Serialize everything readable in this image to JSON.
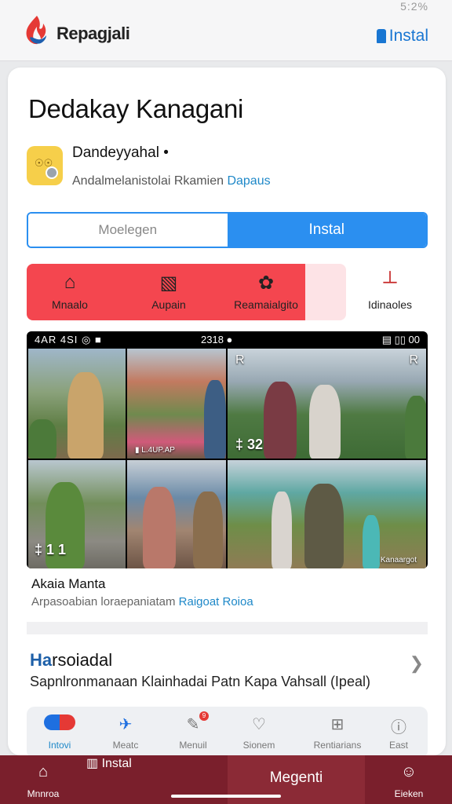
{
  "status": {
    "text": "5:2%"
  },
  "header": {
    "brand": "Repagjali",
    "install_label": "Instal"
  },
  "page": {
    "title": "Dedakay Kanagani"
  },
  "developer": {
    "name": "Dandeyyahal •",
    "subtitle": "Andalmelanistolai Rkamien",
    "link": "Dapaus"
  },
  "actions": {
    "secondary": "Moelegen",
    "primary": "Instal"
  },
  "categories": [
    {
      "label": "Mnaalo",
      "icon": "house-icon"
    },
    {
      "label": "Aupain",
      "icon": "puzzle-icon"
    },
    {
      "label": "Reamaialgito",
      "icon": "flower-icon"
    },
    {
      "label": "Idinaoles",
      "icon": "lamp-icon"
    }
  ],
  "gallery": {
    "status_left": "4AR 4SI ◎ ■",
    "status_center": "2318 ●",
    "status_right": "▤ ▯▯ 00",
    "tile_badge_1": "‡ 32",
    "tile_badge_2": "‡ 1 1",
    "caption_1": "▮ L.4UP.AP",
    "caption_2": "Kanaargot",
    "corner_marks": [
      "R",
      "R"
    ]
  },
  "app": {
    "name": "Akaia Manta",
    "description": "Arpasoabian loraepaniatam",
    "link": "Raigoat Roioa"
  },
  "section": {
    "title_accent": "Ha",
    "title_rest": "rsoiadal",
    "subtitle": "Sapnlronmanaan Klainhadai Patn Kapa Vahsall (Ipeal)"
  },
  "tabs": [
    {
      "label": "Intovi",
      "icon": "toggle-icon"
    },
    {
      "label": "Meatc",
      "icon": "plane-icon"
    },
    {
      "label": "Menuil",
      "icon": "edit-icon",
      "badge": "9"
    },
    {
      "label": "Sionem",
      "icon": "heart-circle-icon"
    },
    {
      "label": "Rentiarians",
      "icon": "plus-square-icon"
    },
    {
      "label": "East",
      "icon": "info-circle-icon"
    }
  ],
  "bottom_nav": [
    {
      "label": "Mnnroa",
      "icon": "home-icon"
    },
    {
      "label": "Instal",
      "icon": "install-icon"
    },
    {
      "label": "Megenti"
    },
    {
      "label": "Eieken",
      "icon": "person-icon"
    }
  ],
  "colors": {
    "accent": "#2b8ff0",
    "red": "#f4464f",
    "nav": "#7a1f2c",
    "link": "#1e88c8"
  }
}
